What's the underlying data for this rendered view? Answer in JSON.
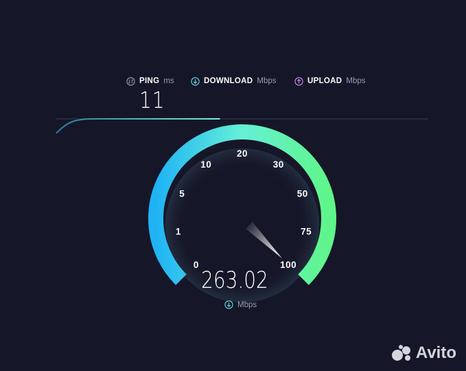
{
  "metrics": {
    "ping": {
      "label": "PING",
      "unit": "ms",
      "value": "11",
      "icon": "ping-icon"
    },
    "download": {
      "label": "DOWNLOAD",
      "unit": "Mbps",
      "icon": "download-arrow-icon"
    },
    "upload": {
      "label": "UPLOAD",
      "unit": "Mbps",
      "icon": "upload-arrow-icon"
    }
  },
  "gauge": {
    "scale_labels": [
      "0",
      "1",
      "5",
      "10",
      "20",
      "30",
      "50",
      "75",
      "100"
    ],
    "current_speed": "263.02",
    "unit": "Mbps",
    "needle_at_label": "100"
  },
  "progress": {
    "fraction": 0.44
  },
  "watermark": {
    "text": "Avito"
  },
  "colors": {
    "background": "#151628",
    "gauge_start": "#1fb3f5",
    "gauge_mid": "#65f0d6",
    "gauge_end": "#5ff58a",
    "download_accent": "#5fd8e6",
    "upload_accent": "#c88cf5"
  }
}
